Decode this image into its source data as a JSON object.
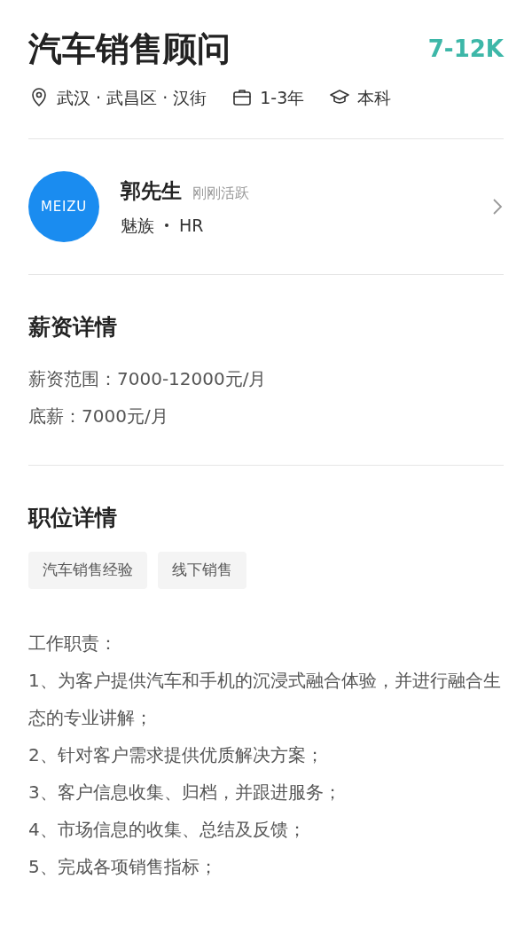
{
  "job": {
    "title": "汽车销售顾问",
    "salary": "7-12K"
  },
  "meta": [
    {
      "kind": "location",
      "text": "武汉 · 武昌区 · 汉街"
    },
    {
      "kind": "experience",
      "text": "1-3年"
    },
    {
      "kind": "education",
      "text": "本科"
    }
  ],
  "recruiter": {
    "logo": "MEIZU",
    "name": "郭先生",
    "status": "刚刚活跃",
    "company": "魅族",
    "role": "HR"
  },
  "salary_details": {
    "heading": "薪资详情",
    "lines": [
      "薪资范围：7000-12000元/月",
      "底薪：7000元/月"
    ]
  },
  "job_details": {
    "heading": "职位详情",
    "tags": [
      "汽车销售经验",
      "线下销售"
    ],
    "description": [
      "工作职责：",
      "1、为客户提供汽车和手机的沉浸式融合体验，并进行融合生态的专业讲解；",
      "2、针对客户需求提供优质解决方案；",
      "3、客户信息收集、归档，并跟进服务；",
      "4、市场信息的收集、总结及反馈；",
      "5、完成各项销售指标；"
    ]
  }
}
